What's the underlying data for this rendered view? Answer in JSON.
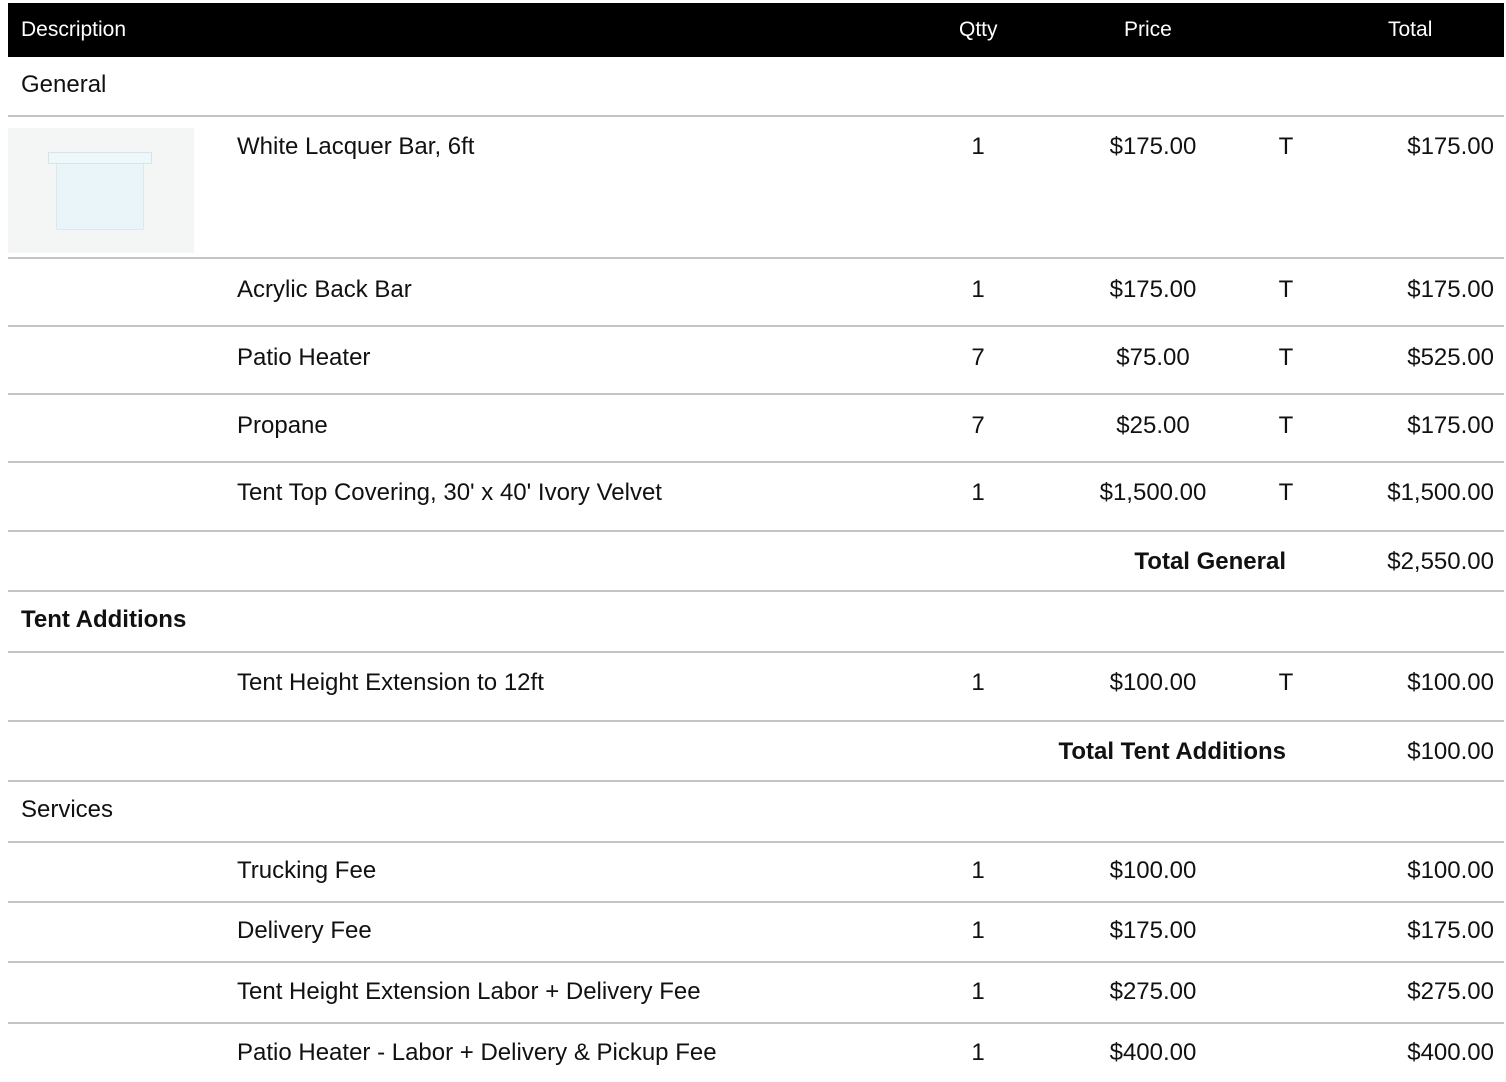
{
  "header": {
    "description": "Description",
    "qty": "Qtty",
    "price": "Price",
    "total": "Total"
  },
  "sections": [
    {
      "name": "General",
      "items": [
        {
          "description": "White Lacquer Bar, 6ft",
          "qty": "1",
          "price": "$175.00",
          "tax": "T",
          "total": "$175.00",
          "image": "white-lacquer-bar-thumbnail"
        },
        {
          "description": "Acrylic Back Bar",
          "qty": "1",
          "price": "$175.00",
          "tax": "T",
          "total": "$175.00"
        },
        {
          "description": "Patio Heater",
          "qty": "7",
          "price": "$75.00",
          "tax": "T",
          "total": "$525.00"
        },
        {
          "description": "Propane",
          "qty": "7",
          "price": "$25.00",
          "tax": "T",
          "total": "$175.00"
        },
        {
          "description": "Tent Top Covering, 30' x 40' Ivory Velvet",
          "qty": "1",
          "price": "$1,500.00",
          "tax": "T",
          "total": "$1,500.00"
        }
      ],
      "subtotal_label": "Total General",
      "subtotal": "$2,550.00"
    },
    {
      "name": "Tent Additions",
      "items": [
        {
          "description": "Tent Height Extension to 12ft",
          "qty": "1",
          "price": "$100.00",
          "tax": "T",
          "total": "$100.00"
        }
      ],
      "subtotal_label": "Total Tent Additions",
      "subtotal": "$100.00"
    },
    {
      "name": "Services",
      "items": [
        {
          "description": "Trucking Fee",
          "qty": "1",
          "price": "$100.00",
          "tax": "",
          "total": "$100.00"
        },
        {
          "description": "Delivery Fee",
          "qty": "1",
          "price": "$175.00",
          "tax": "",
          "total": "$175.00"
        },
        {
          "description": "Tent Height Extension Labor + Delivery Fee",
          "qty": "1",
          "price": "$275.00",
          "tax": "",
          "total": "$275.00"
        },
        {
          "description": "Patio Heater - Labor + Delivery & Pickup Fee",
          "qty": "1",
          "price": "$400.00",
          "tax": "",
          "total": "$400.00"
        }
      ]
    }
  ]
}
